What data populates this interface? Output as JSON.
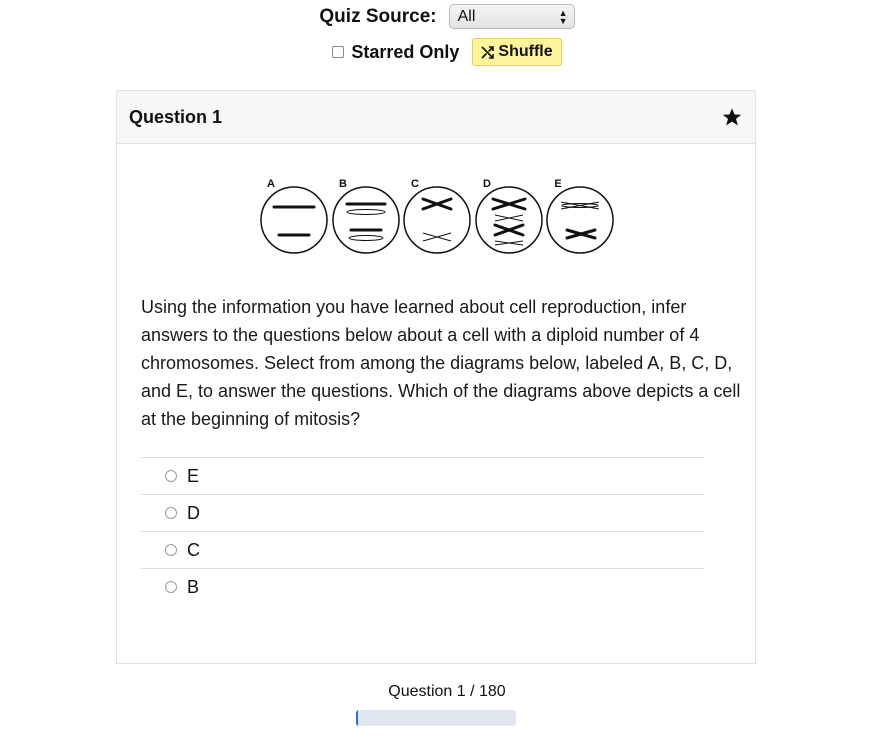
{
  "controls": {
    "source_label": "Quiz Source:",
    "source_value": "All",
    "starred_label": "Starred Only",
    "starred_checked": false,
    "shuffle_label": "Shuffle",
    "shuffle_color": "#fff59d"
  },
  "question": {
    "title": "Question 1",
    "starred": true,
    "diagram_labels": [
      "A",
      "B",
      "C",
      "D",
      "E"
    ],
    "text": "Using the information you have learned about cell reproduction, infer answers to the questions below about a cell with a diploid number of 4 chromosomes. Select from among the diagrams below, labeled A, B, C, D, and E, to answer the questions. Which of the diagrams above depicts a cell at the beginning of mitosis?",
    "options": [
      {
        "label": "E"
      },
      {
        "label": "D"
      },
      {
        "label": "C"
      },
      {
        "label": "B"
      }
    ]
  },
  "progress": {
    "text": "Question 1 / 180",
    "fraction": 0.0056,
    "accent": "#2b6cd6"
  }
}
